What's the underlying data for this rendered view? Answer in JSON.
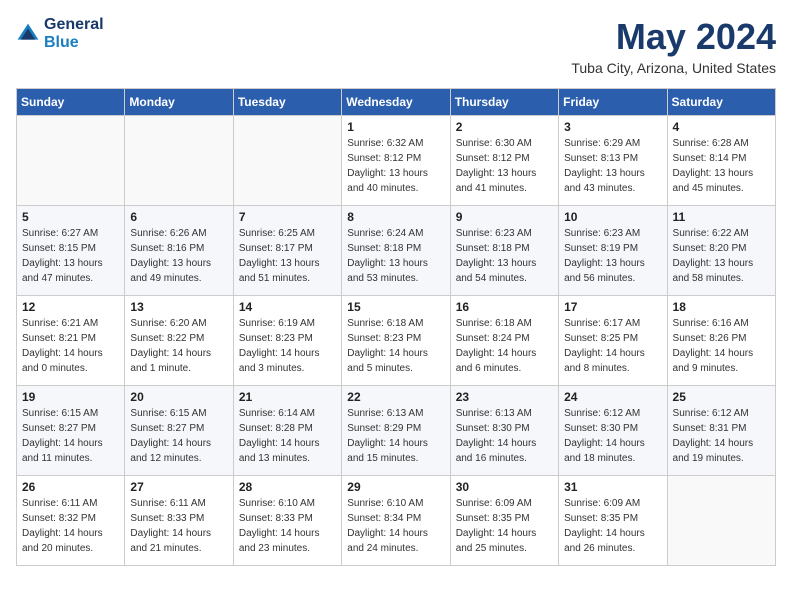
{
  "header": {
    "logo_line1": "General",
    "logo_line2": "Blue",
    "month": "May 2024",
    "location": "Tuba City, Arizona, United States"
  },
  "weekdays": [
    "Sunday",
    "Monday",
    "Tuesday",
    "Wednesday",
    "Thursday",
    "Friday",
    "Saturday"
  ],
  "weeks": [
    [
      {
        "day": "",
        "info": ""
      },
      {
        "day": "",
        "info": ""
      },
      {
        "day": "",
        "info": ""
      },
      {
        "day": "1",
        "info": "Sunrise: 6:32 AM\nSunset: 8:12 PM\nDaylight: 13 hours\nand 40 minutes."
      },
      {
        "day": "2",
        "info": "Sunrise: 6:30 AM\nSunset: 8:12 PM\nDaylight: 13 hours\nand 41 minutes."
      },
      {
        "day": "3",
        "info": "Sunrise: 6:29 AM\nSunset: 8:13 PM\nDaylight: 13 hours\nand 43 minutes."
      },
      {
        "day": "4",
        "info": "Sunrise: 6:28 AM\nSunset: 8:14 PM\nDaylight: 13 hours\nand 45 minutes."
      }
    ],
    [
      {
        "day": "5",
        "info": "Sunrise: 6:27 AM\nSunset: 8:15 PM\nDaylight: 13 hours\nand 47 minutes."
      },
      {
        "day": "6",
        "info": "Sunrise: 6:26 AM\nSunset: 8:16 PM\nDaylight: 13 hours\nand 49 minutes."
      },
      {
        "day": "7",
        "info": "Sunrise: 6:25 AM\nSunset: 8:17 PM\nDaylight: 13 hours\nand 51 minutes."
      },
      {
        "day": "8",
        "info": "Sunrise: 6:24 AM\nSunset: 8:18 PM\nDaylight: 13 hours\nand 53 minutes."
      },
      {
        "day": "9",
        "info": "Sunrise: 6:23 AM\nSunset: 8:18 PM\nDaylight: 13 hours\nand 54 minutes."
      },
      {
        "day": "10",
        "info": "Sunrise: 6:23 AM\nSunset: 8:19 PM\nDaylight: 13 hours\nand 56 minutes."
      },
      {
        "day": "11",
        "info": "Sunrise: 6:22 AM\nSunset: 8:20 PM\nDaylight: 13 hours\nand 58 minutes."
      }
    ],
    [
      {
        "day": "12",
        "info": "Sunrise: 6:21 AM\nSunset: 8:21 PM\nDaylight: 14 hours\nand 0 minutes."
      },
      {
        "day": "13",
        "info": "Sunrise: 6:20 AM\nSunset: 8:22 PM\nDaylight: 14 hours\nand 1 minute."
      },
      {
        "day": "14",
        "info": "Sunrise: 6:19 AM\nSunset: 8:23 PM\nDaylight: 14 hours\nand 3 minutes."
      },
      {
        "day": "15",
        "info": "Sunrise: 6:18 AM\nSunset: 8:23 PM\nDaylight: 14 hours\nand 5 minutes."
      },
      {
        "day": "16",
        "info": "Sunrise: 6:18 AM\nSunset: 8:24 PM\nDaylight: 14 hours\nand 6 minutes."
      },
      {
        "day": "17",
        "info": "Sunrise: 6:17 AM\nSunset: 8:25 PM\nDaylight: 14 hours\nand 8 minutes."
      },
      {
        "day": "18",
        "info": "Sunrise: 6:16 AM\nSunset: 8:26 PM\nDaylight: 14 hours\nand 9 minutes."
      }
    ],
    [
      {
        "day": "19",
        "info": "Sunrise: 6:15 AM\nSunset: 8:27 PM\nDaylight: 14 hours\nand 11 minutes."
      },
      {
        "day": "20",
        "info": "Sunrise: 6:15 AM\nSunset: 8:27 PM\nDaylight: 14 hours\nand 12 minutes."
      },
      {
        "day": "21",
        "info": "Sunrise: 6:14 AM\nSunset: 8:28 PM\nDaylight: 14 hours\nand 13 minutes."
      },
      {
        "day": "22",
        "info": "Sunrise: 6:13 AM\nSunset: 8:29 PM\nDaylight: 14 hours\nand 15 minutes."
      },
      {
        "day": "23",
        "info": "Sunrise: 6:13 AM\nSunset: 8:30 PM\nDaylight: 14 hours\nand 16 minutes."
      },
      {
        "day": "24",
        "info": "Sunrise: 6:12 AM\nSunset: 8:30 PM\nDaylight: 14 hours\nand 18 minutes."
      },
      {
        "day": "25",
        "info": "Sunrise: 6:12 AM\nSunset: 8:31 PM\nDaylight: 14 hours\nand 19 minutes."
      }
    ],
    [
      {
        "day": "26",
        "info": "Sunrise: 6:11 AM\nSunset: 8:32 PM\nDaylight: 14 hours\nand 20 minutes."
      },
      {
        "day": "27",
        "info": "Sunrise: 6:11 AM\nSunset: 8:33 PM\nDaylight: 14 hours\nand 21 minutes."
      },
      {
        "day": "28",
        "info": "Sunrise: 6:10 AM\nSunset: 8:33 PM\nDaylight: 14 hours\nand 23 minutes."
      },
      {
        "day": "29",
        "info": "Sunrise: 6:10 AM\nSunset: 8:34 PM\nDaylight: 14 hours\nand 24 minutes."
      },
      {
        "day": "30",
        "info": "Sunrise: 6:09 AM\nSunset: 8:35 PM\nDaylight: 14 hours\nand 25 minutes."
      },
      {
        "day": "31",
        "info": "Sunrise: 6:09 AM\nSunset: 8:35 PM\nDaylight: 14 hours\nand 26 minutes."
      },
      {
        "day": "",
        "info": ""
      }
    ]
  ]
}
